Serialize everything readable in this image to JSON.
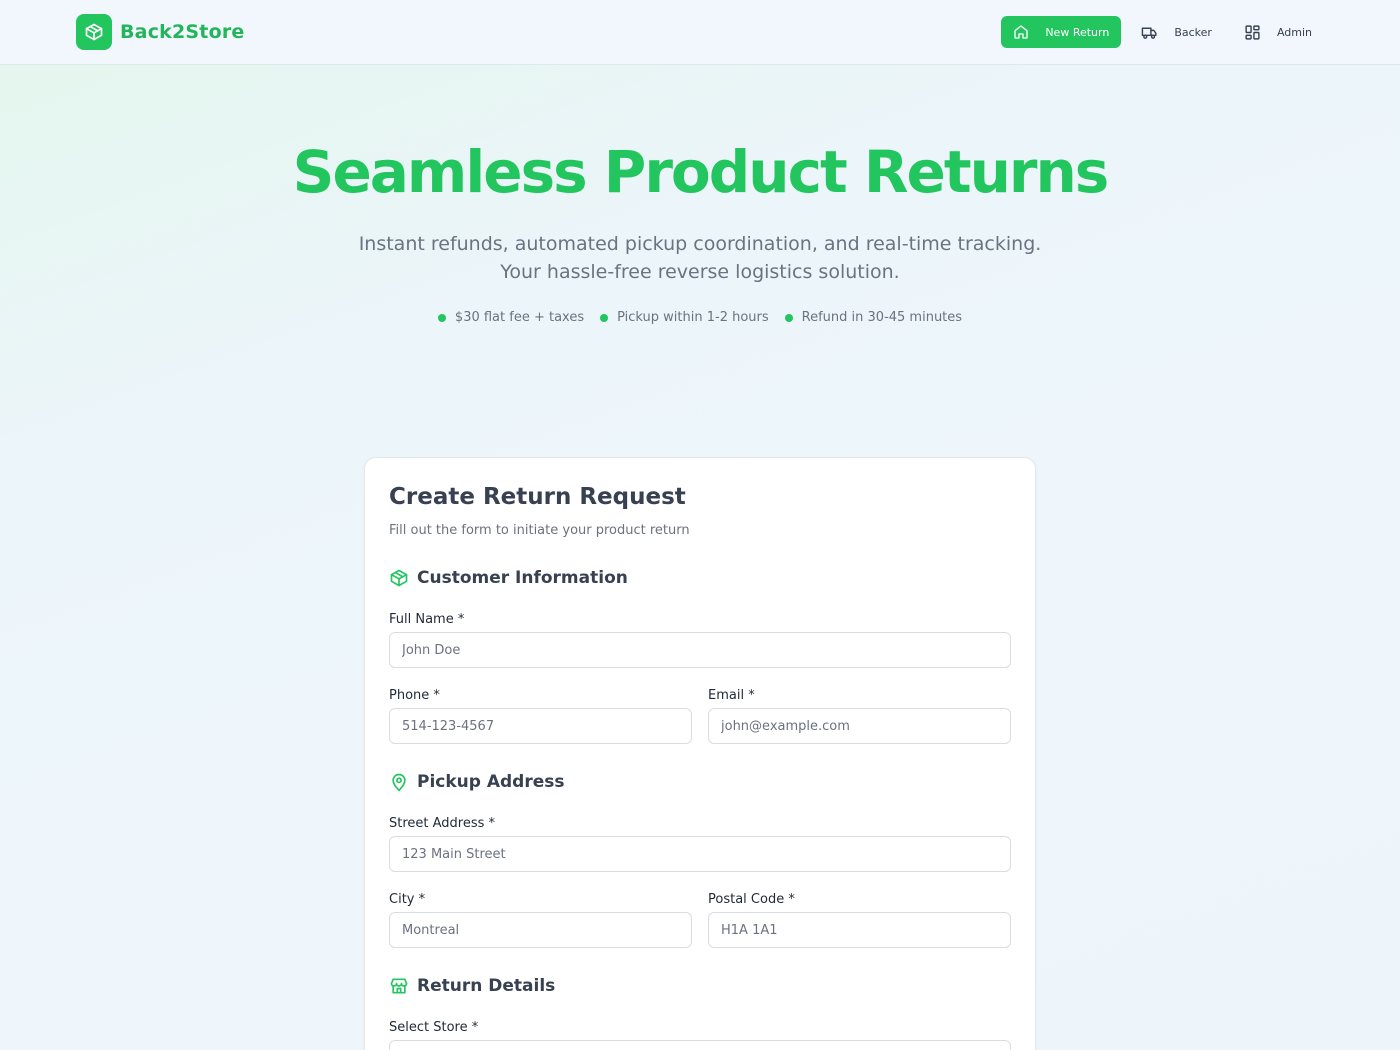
{
  "brand": {
    "name": "Back2Store",
    "logo_icon": "package-icon",
    "color": "#22c55e"
  },
  "nav": {
    "new_return": "New Return",
    "backer": "Backer",
    "admin": "Admin"
  },
  "hero": {
    "title": "Seamless Product Returns",
    "subtitle_line1": "Instant refunds, automated pickup coordination, and real-time tracking.",
    "subtitle_line2": "Your hassle-free reverse logistics solution.",
    "features": [
      "$30 flat fee + taxes",
      "Pickup within 1-2 hours",
      "Refund in 30-45 minutes"
    ]
  },
  "form": {
    "title": "Create Return Request",
    "subtitle": "Fill out the form to initiate your product return",
    "customer_section": "Customer Information",
    "full_name_label": "Full Name *",
    "full_name_placeholder": "John Doe",
    "phone_label": "Phone *",
    "phone_placeholder": "514-123-4567",
    "email_label": "Email *",
    "email_placeholder": "john@example.com",
    "pickup_section": "Pickup Address",
    "street_label": "Street Address *",
    "street_placeholder": "123 Main Street",
    "city_label": "City *",
    "city_placeholder": "Montreal",
    "postal_label": "Postal Code *",
    "postal_placeholder": "H1A 1A1",
    "return_section": "Return Details",
    "store_label": "Select Store *"
  }
}
